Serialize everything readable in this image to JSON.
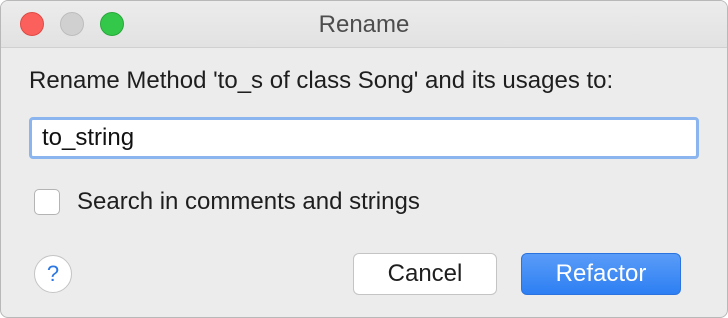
{
  "window": {
    "title": "Rename"
  },
  "dialog": {
    "prompt": "Rename Method 'to_s of class Song' and its usages to:",
    "name_value": "to_string",
    "search_option": {
      "label": "Search in comments and strings",
      "checked": false
    },
    "help_glyph": "?",
    "cancel_label": "Cancel",
    "refactor_label": "Refactor"
  },
  "colors": {
    "accent": "#2d7ff3",
    "focus_ring": "#8ab5ee",
    "close": "#fc605c",
    "zoom": "#34c84a"
  }
}
